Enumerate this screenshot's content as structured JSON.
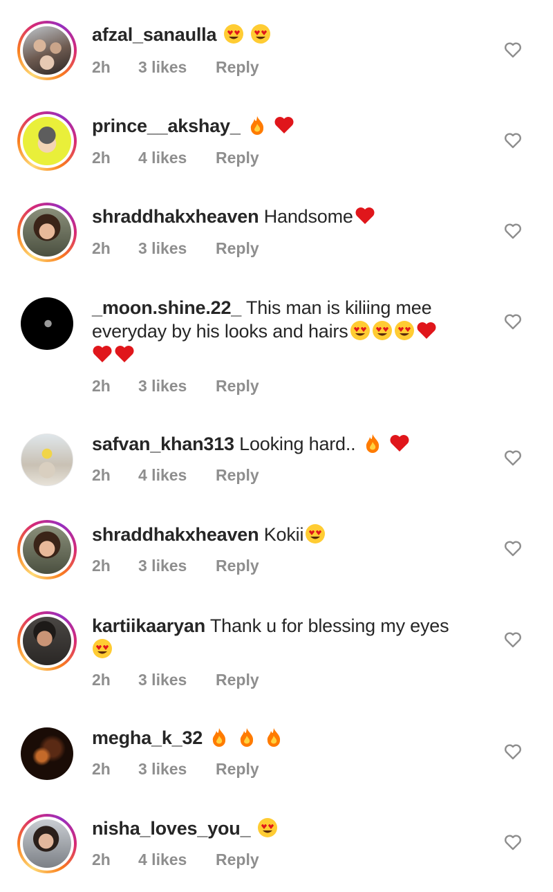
{
  "colors": {
    "text": "#262626",
    "meta": "#8e8e8e",
    "heart_emoji": "#e0161b",
    "fire_outer": "#ff7b00",
    "face_emoji": "#ffcc33",
    "ring_gradient": [
      "#feda75",
      "#fa7e1e",
      "#d62976",
      "#962fbf"
    ]
  },
  "comments": [
    {
      "username": "afzal_sanaulla",
      "message": "",
      "emojis": [
        "heart-eyes-emoji",
        "heart-eyes-emoji"
      ],
      "time": "2h",
      "likes": "3 likes",
      "reply": "Reply",
      "avatar": "family-photo-avatar",
      "story_ring": true
    },
    {
      "username": "prince__akshay_",
      "message": "",
      "emojis": [
        "fire-emoji",
        "red-heart-emoji"
      ],
      "time": "2h",
      "likes": "4 likes",
      "reply": "Reply",
      "avatar": "cartoon-avatar",
      "story_ring": true
    },
    {
      "username": "shraddhakxheaven",
      "message": "Handsome",
      "emojis": [
        "red-heart-emoji"
      ],
      "time": "2h",
      "likes": "3 likes",
      "reply": "Reply",
      "avatar": "woman-portrait-avatar",
      "story_ring": true
    },
    {
      "username": "_moon.shine.22_",
      "message": "This man is kiliing mee everyday by his looks and hairs",
      "emojis": [
        "heart-eyes-emoji",
        "heart-eyes-emoji",
        "heart-eyes-emoji",
        "red-heart-emoji",
        "red-heart-emoji",
        "red-heart-emoji"
      ],
      "time": "2h",
      "likes": "3 likes",
      "reply": "Reply",
      "avatar": "moon-avatar",
      "story_ring": false
    },
    {
      "username": "safvan_khan313",
      "message": "Looking hard..",
      "emojis": [
        "fire-emoji",
        "red-heart-emoji"
      ],
      "time": "2h",
      "likes": "4 likes",
      "reply": "Reply",
      "avatar": "outdoor-photo-avatar",
      "story_ring": false
    },
    {
      "username": "shraddhakxheaven",
      "message": "Kokii",
      "emojis": [
        "heart-eyes-emoji"
      ],
      "time": "2h",
      "likes": "3 likes",
      "reply": "Reply",
      "avatar": "woman-portrait-avatar",
      "story_ring": true
    },
    {
      "username": "kartiikaaryan",
      "message": "Thank u for blessing my eyes",
      "emojis": [
        "heart-eyes-emoji"
      ],
      "time": "2h",
      "likes": "3 likes",
      "reply": "Reply",
      "avatar": "man-portrait-avatar",
      "story_ring": true
    },
    {
      "username": "megha_k_32",
      "message": "",
      "emojis": [
        "fire-emoji",
        "fire-emoji",
        "fire-emoji"
      ],
      "time": "2h",
      "likes": "3 likes",
      "reply": "Reply",
      "avatar": "dark-portrait-avatar",
      "story_ring": false
    },
    {
      "username": "nisha_loves_you_",
      "message": "",
      "emojis": [
        "heart-eyes-emoji"
      ],
      "time": "2h",
      "likes": "4 likes",
      "reply": "Reply",
      "avatar": "woman-selfie-avatar",
      "story_ring": true
    }
  ]
}
